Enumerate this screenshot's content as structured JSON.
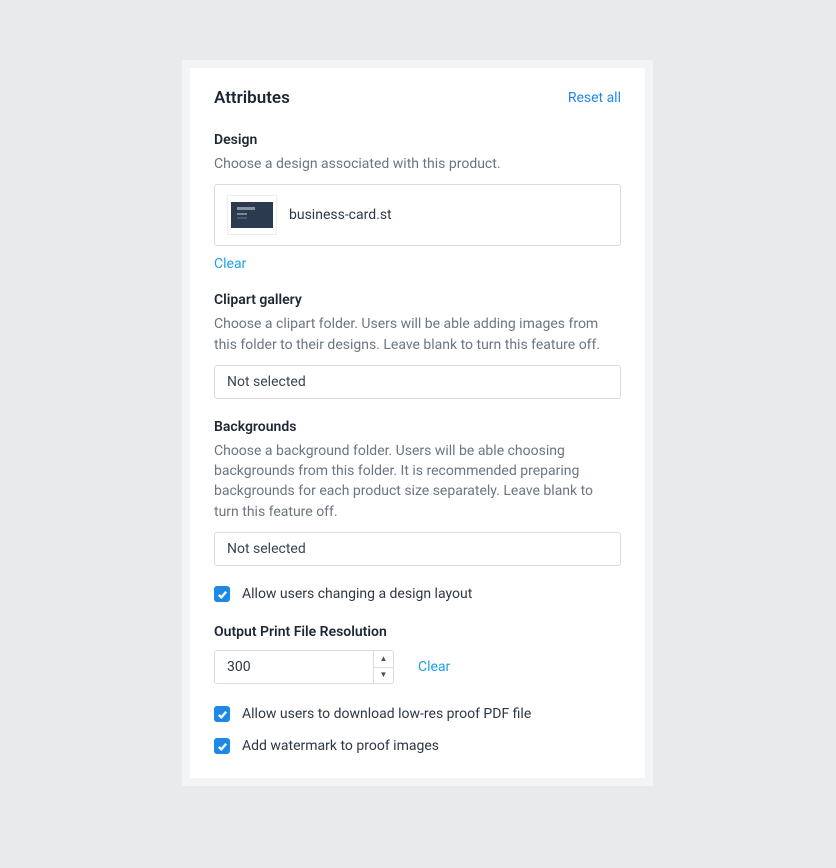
{
  "header": {
    "title": "Attributes",
    "reset_label": "Reset all"
  },
  "design": {
    "label": "Design",
    "description": "Choose a design associated with this product.",
    "selected_name": "business-card.st",
    "clear_label": "Clear"
  },
  "clipart": {
    "label": "Clipart gallery",
    "description": "Choose a clipart folder. Users will be able adding images from this folder to their designs. Leave blank to turn this feature off.",
    "value": "Not selected"
  },
  "backgrounds": {
    "label": "Backgrounds",
    "description": "Choose a background folder. Users will be able choosing backgrounds from this folder. It is recommended preparing backgrounds for each product size separately. Leave blank to turn this feature off.",
    "value": "Not selected"
  },
  "allow_layout_change": {
    "checked": true,
    "label": "Allow users changing a design layout"
  },
  "resolution": {
    "label": "Output Print File Resolution",
    "value": "300",
    "clear_label": "Clear"
  },
  "allow_proof_pdf": {
    "checked": true,
    "label": "Allow users to download low-res proof PDF file"
  },
  "watermark": {
    "checked": true,
    "label": "Add watermark to proof images"
  }
}
